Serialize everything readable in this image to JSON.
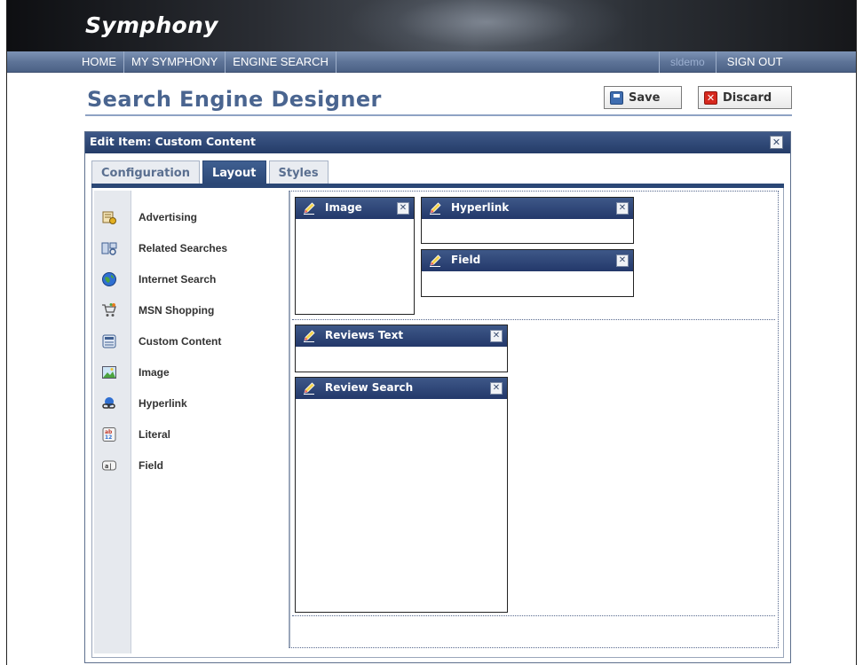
{
  "app": {
    "logo": "Symphony"
  },
  "nav": {
    "items": [
      "HOME",
      "MY SYMPHONY",
      "ENGINE SEARCH"
    ],
    "user": "sldemo",
    "sign_out": "SIGN OUT"
  },
  "page": {
    "title": "Search Engine Designer"
  },
  "toolbar": {
    "save_label": "Save",
    "discard_label": "Discard"
  },
  "dialog": {
    "title": "Edit Item: Custom Content",
    "tabs": [
      {
        "label": "Configuration",
        "active": false
      },
      {
        "label": "Layout",
        "active": true
      },
      {
        "label": "Styles",
        "active": false
      }
    ]
  },
  "palette": {
    "items": [
      {
        "label": "Advertising",
        "icon": "advertising-icon"
      },
      {
        "label": "Related Searches",
        "icon": "related-searches-icon"
      },
      {
        "label": "Internet Search",
        "icon": "globe-icon"
      },
      {
        "label": "MSN Shopping",
        "icon": "shopping-cart-icon"
      },
      {
        "label": "Custom Content",
        "icon": "custom-content-icon"
      },
      {
        "label": "Image",
        "icon": "image-icon"
      },
      {
        "label": "Hyperlink",
        "icon": "hyperlink-icon"
      },
      {
        "label": "Literal",
        "icon": "literal-icon"
      },
      {
        "label": "Field",
        "icon": "field-icon"
      }
    ]
  },
  "layout": {
    "widgets": {
      "image": "Image",
      "hyperlink": "Hyperlink",
      "field": "Field",
      "reviews_text": "Reviews Text",
      "review_search": "Review Search"
    }
  },
  "colors": {
    "header_blue": "#2b4775",
    "title_blue": "#4a6590",
    "nav_blue": "#5e7498"
  }
}
